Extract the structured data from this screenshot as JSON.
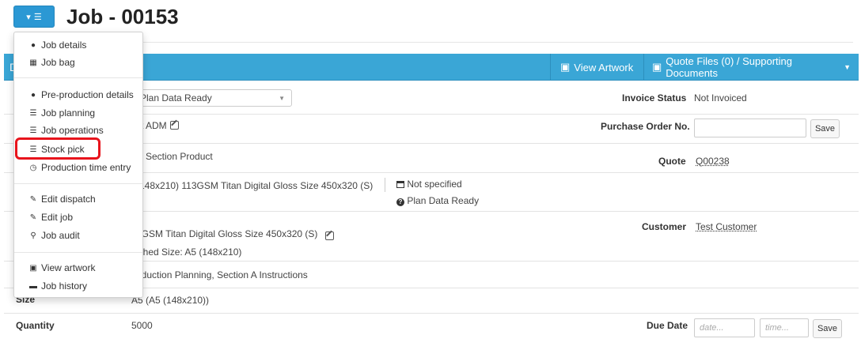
{
  "header": {
    "title": "Job - 00153"
  },
  "panel": {
    "left_letter": "D",
    "view_artwork": "View Artwork",
    "quote_files": "Quote Files (0) / Supporting Documents"
  },
  "menu": {
    "items": [
      {
        "label": "Job details",
        "icon": "info-circle-icon"
      },
      {
        "label": "Job bag",
        "icon": "calculator-icon"
      },
      {
        "label": "Pre-production details",
        "icon": "info-circle-icon"
      },
      {
        "label": "Job planning",
        "icon": "list-icon"
      },
      {
        "label": "Job operations",
        "icon": "list-icon"
      },
      {
        "label": "Stock pick",
        "icon": "list-icon"
      },
      {
        "label": "Production time entry",
        "icon": "clock-icon"
      },
      {
        "label": "Edit dispatch",
        "icon": "edit-icon"
      },
      {
        "label": "Edit job",
        "icon": "edit-icon"
      },
      {
        "label": "Job audit",
        "icon": "search-icon"
      },
      {
        "label": "View artwork",
        "icon": "image-icon"
      },
      {
        "label": "Job history",
        "icon": "folder-icon"
      }
    ]
  },
  "rows": {
    "status_select": "Plan Data Ready",
    "invoice_status_label": "Invoice Status",
    "invoice_status_value": "Not Invoiced",
    "row2_value": "st ADM",
    "purchase_order_label": "Purchase Order No.",
    "save_label": "Save",
    "row3_value": "lti Section Product",
    "quote_label": "Quote",
    "quote_value": "Q00238",
    "row4_value": "(148x210) 113GSM Titan Digital Gloss Size 450x320 (S)",
    "not_specified": "Not specified",
    "plan_data_ready": "Plan Data Ready",
    "row5_value": "3GSM Titan Digital Gloss Size 450x320 (S)",
    "row5_sub": "ished Size: A5 (148x210)",
    "customer_label": "Customer",
    "customer_value": "Test Customer",
    "row6_value": "oduction Planning, Section A Instructions",
    "size_label": "Size",
    "size_value": "A5 (A5 (148x210))",
    "quantity_label": "Quantity",
    "quantity_value": "5000",
    "due_date_label": "Due Date",
    "date_placeholder": "date...",
    "time_placeholder": "time..."
  },
  "colors": {
    "primary": "#3aa6d6",
    "highlight": "#e8141c"
  }
}
